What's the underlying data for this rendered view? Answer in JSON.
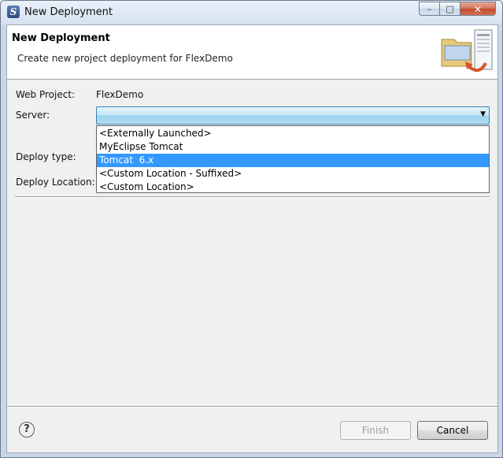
{
  "window": {
    "title": "New Deployment",
    "app_icon": "S",
    "controls": {
      "minimize": "–",
      "maximize": "□",
      "close": "✕"
    }
  },
  "header": {
    "title": "New Deployment",
    "description": "Create new project deployment for FlexDemo",
    "icon": "deployment-wizard-icon"
  },
  "form": {
    "web_project_label": "Web Project:",
    "web_project_value": "FlexDemo",
    "server_label": "Server:",
    "server_value": "",
    "deploy_type_label": "Deploy type:",
    "deploy_location_label": "Deploy Location:"
  },
  "dropdown": {
    "items": [
      {
        "label": "<Externally Launched>",
        "selected": false
      },
      {
        "label": "MyEclipse Tomcat",
        "selected": false
      },
      {
        "label": "Tomcat  6.x",
        "selected": true
      },
      {
        "label": "<Custom Location - Suffixed>",
        "selected": false
      },
      {
        "label": "<Custom Location>",
        "selected": false
      }
    ]
  },
  "footer": {
    "help": "?",
    "finish_label": "Finish",
    "cancel_label": "Cancel"
  },
  "colors": {
    "selection": "#3399ff",
    "combo_border": "#3c7fb1"
  }
}
